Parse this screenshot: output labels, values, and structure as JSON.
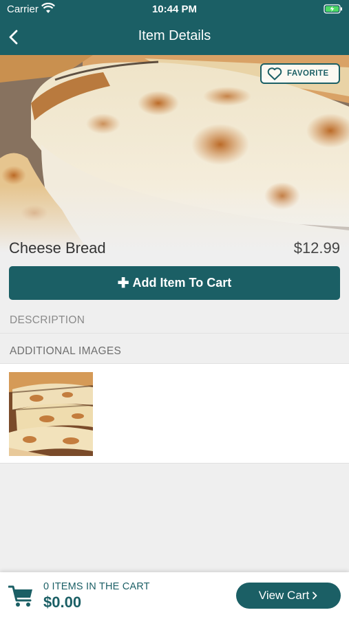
{
  "status": {
    "carrier": "Carrier",
    "time": "10:44 PM"
  },
  "nav": {
    "title": "Item Details",
    "back_icon": "chevron-left-icon"
  },
  "hero": {
    "image": "cheese-bread-photo",
    "favorite_label": "FAVORITE",
    "favorite_icon": "heart-outline-icon"
  },
  "item": {
    "name": "Cheese Bread",
    "price": "$12.99"
  },
  "actions": {
    "add_to_cart_label": "Add Item To Cart",
    "add_to_cart_icon": "plus-icon"
  },
  "sections": {
    "description_label": "DESCRIPTION",
    "additional_images_label": "ADDITIONAL IMAGES"
  },
  "cart": {
    "count_text": "0 ITEMS IN THE CART",
    "total": "$0.00",
    "view_cart_label": "View Cart",
    "view_cart_icon": "chevron-right-icon"
  },
  "colors": {
    "brand": "#1b5f65",
    "background": "#efefef"
  }
}
